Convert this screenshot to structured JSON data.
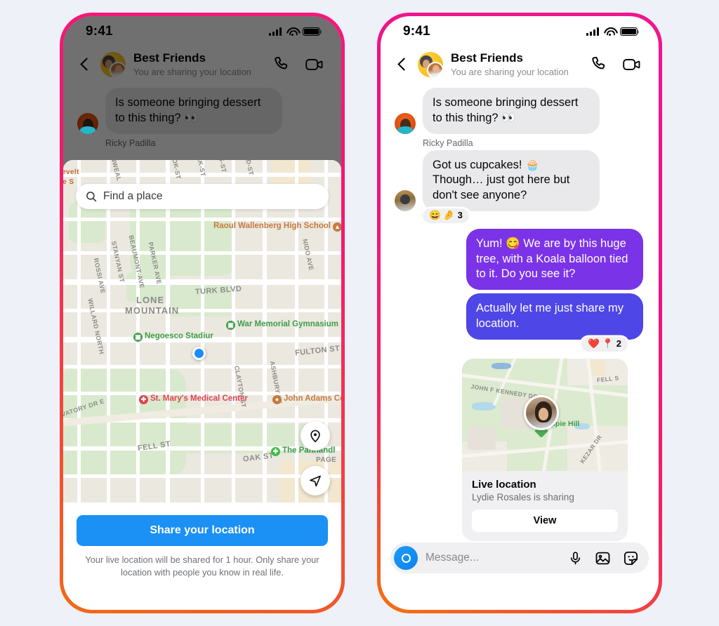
{
  "page": {
    "background": "#eef1f7",
    "accent_blue": "#1b90f5",
    "bubble_purple_1": "#7b33e8",
    "bubble_purple_2": "#4f46e8",
    "frame_gradient_from": "#f5197c",
    "frame_gradient_to": "#f26a15"
  },
  "status_bar": {
    "time": "9:41",
    "signal": "signal-icon",
    "wifi": "wifi-icon",
    "battery": "battery-icon"
  },
  "chat_header": {
    "back": "back-chevron-icon",
    "avatar": "group-avatar",
    "title": "Best Friends",
    "subtitle": "You are sharing your location",
    "call": "phone-call-icon",
    "video": "video-camera-icon"
  },
  "messages": [
    {
      "id": "m1",
      "direction": "in",
      "sender": "",
      "text": "Is someone bringing dessert to this thing? 👀",
      "avatar": "avatar-woman",
      "reactions": null
    },
    {
      "id": "m2",
      "direction": "in",
      "sender": "Ricky Padilla",
      "text": "Got us cupcakes! 🧁 Though… just got here but don't see anyone?",
      "avatar": "avatar-man",
      "reactions": {
        "emojis": [
          "😄",
          "🤌"
        ],
        "count": "3"
      }
    },
    {
      "id": "m3",
      "direction": "out",
      "sender": "",
      "text": "Yum! 😋 We are by this huge tree, with a Koala balloon tied to it. Do you see it?",
      "color": "#7b33e8",
      "reactions": null
    },
    {
      "id": "m4",
      "direction": "out",
      "sender": "",
      "text": "Actually let me just share my location.",
      "color": "#4f46e8",
      "reactions": {
        "emojis": [
          "❤️",
          "📍"
        ],
        "count": "2"
      }
    }
  ],
  "location_sheet": {
    "search_placeholder": "Find a place",
    "search_icon": "search-icon",
    "share_button": "Share your location",
    "note": "Your live location will be shared for 1 hour. Only share your location with people you know in real life.",
    "fab_place": "place-pin-icon",
    "fab_locate": "navigate-arrow-icon",
    "user_marker": "current-location-dot",
    "map_pois": [
      {
        "name": "Raoul Wallenberg High School",
        "color": "#c47a3e",
        "glyph": "▲"
      },
      {
        "name": "Negoesco Stadiur",
        "color": "#3f9c48",
        "glyph": "▣"
      },
      {
        "name": "War Memorial Gymnasium",
        "color": "#3f9c48",
        "glyph": "▣"
      },
      {
        "name": "St. Mary's Medical Center",
        "color": "#e0434f",
        "glyph": "✚"
      },
      {
        "name": "John Adams Center",
        "color": "#c47a3e",
        "glyph": "●"
      },
      {
        "name": "The Panhandl",
        "color": "#3f9c48",
        "glyph": "✚"
      }
    ],
    "map_labels": [
      "evelt",
      "le S",
      "NWEAL",
      "OOK-ST",
      "AK-ST",
      "S-ST",
      "OD-ST",
      "STANYAN ST",
      "BEAUMONT-AVE",
      "PARKER AVE",
      "ROSSI AVE",
      "NIDO AVE",
      "TURK BLVD",
      "LONE",
      "MOUNTAIN",
      "WILLARD NORTH",
      "FULTON ST",
      "CLAYTON ST",
      "ASHBURY ST",
      "VATORY DR E",
      "FELL ST",
      "OAK ST",
      "PAGE"
    ]
  },
  "live_location_card": {
    "title": "Live location",
    "subtitle": "Lydie Rosales is sharing",
    "view_button": "View",
    "avatar": "avatar-lydie",
    "map_labels": [
      "JOHN F KENNEDY DR",
      "FELL S",
      "KEZAR DR"
    ],
    "map_poi": "Hippie Hill"
  },
  "composer": {
    "camera": "camera-icon",
    "placeholder": "Message...",
    "mic": "microphone-icon",
    "gallery": "image-icon",
    "sticker": "sticker-icon"
  }
}
